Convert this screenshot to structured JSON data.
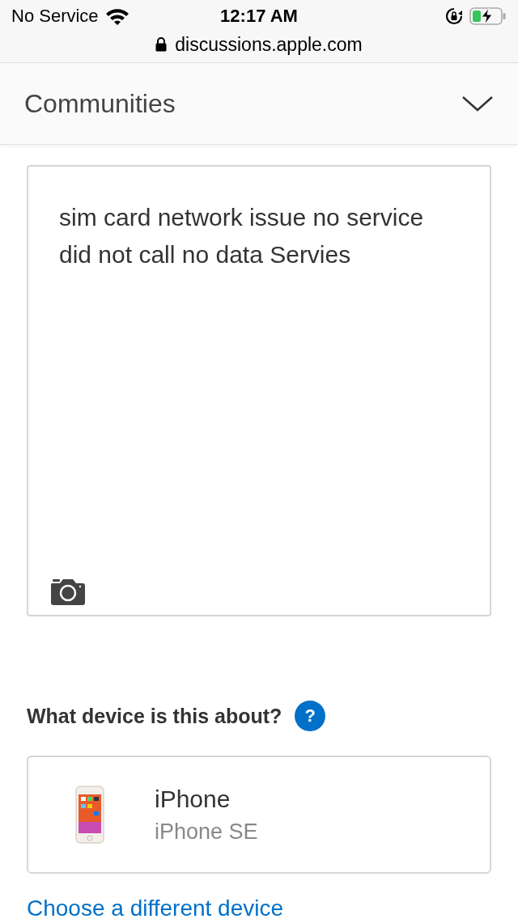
{
  "status_bar": {
    "carrier": "No Service",
    "time": "12:17 AM"
  },
  "address_bar": {
    "url": "discussions.apple.com"
  },
  "header": {
    "title": "Communities",
    "expanded": false
  },
  "message": {
    "value": "sim card network issue no service did not call no data Servies"
  },
  "device_section": {
    "heading": "What device is this about?",
    "help": "?"
  },
  "device": {
    "name": "iPhone",
    "model": "iPhone SE"
  },
  "change_link": "Choose a different device"
}
